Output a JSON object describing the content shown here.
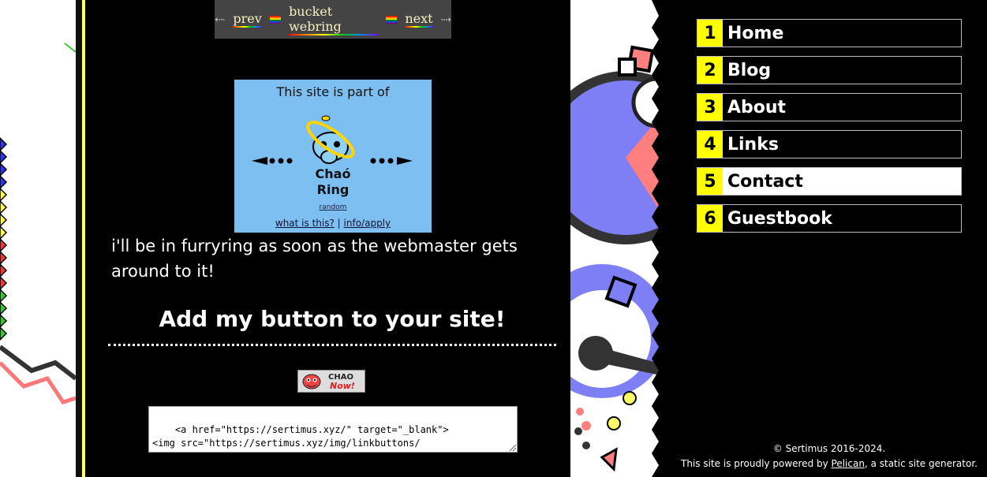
{
  "webring": {
    "left_arrow": "⇠",
    "prev": "prev",
    "name": "bucket webring",
    "next": "next",
    "right_arrow": "⇢"
  },
  "chao_ring": {
    "intro": "This site is part of",
    "name_line1": "Chaó",
    "name_line2": "Ring",
    "random": "random",
    "what": "what is this?",
    "separator": "|",
    "info": "info/apply"
  },
  "furry_text": "i'll be in furryring as soon as the webmaster gets around to it!",
  "heading": "Add my button to your site!",
  "button_badge": {
    "line1": "CHAO",
    "line2": "Now!"
  },
  "code_snippet": "<a href=\"https://sertimus.xyz/\" target=\"_blank\">\n<img src=\"https://sertimus.xyz/img/linkbuttons/\nsertimus_chao_now.gif\"",
  "nav": [
    {
      "num": "1",
      "label": "Home"
    },
    {
      "num": "2",
      "label": "Blog"
    },
    {
      "num": "3",
      "label": "About"
    },
    {
      "num": "4",
      "label": "Links"
    },
    {
      "num": "5",
      "label": "Contact",
      "active": true
    },
    {
      "num": "6",
      "label": "Guestbook"
    }
  ],
  "footer": {
    "copyright": "© Sertimus 2016-2024.",
    "powered_prefix": "This site is proudly powered by ",
    "powered_link": "Pelican",
    "powered_suffix": ", a static site generator."
  },
  "colors": {
    "nav_number_bg": "#ffff00",
    "chao_bg": "#7dbff0",
    "webring_bg": "#444444",
    "deco_blue": "#7f7ff5",
    "deco_red": "#ff7f7f"
  }
}
